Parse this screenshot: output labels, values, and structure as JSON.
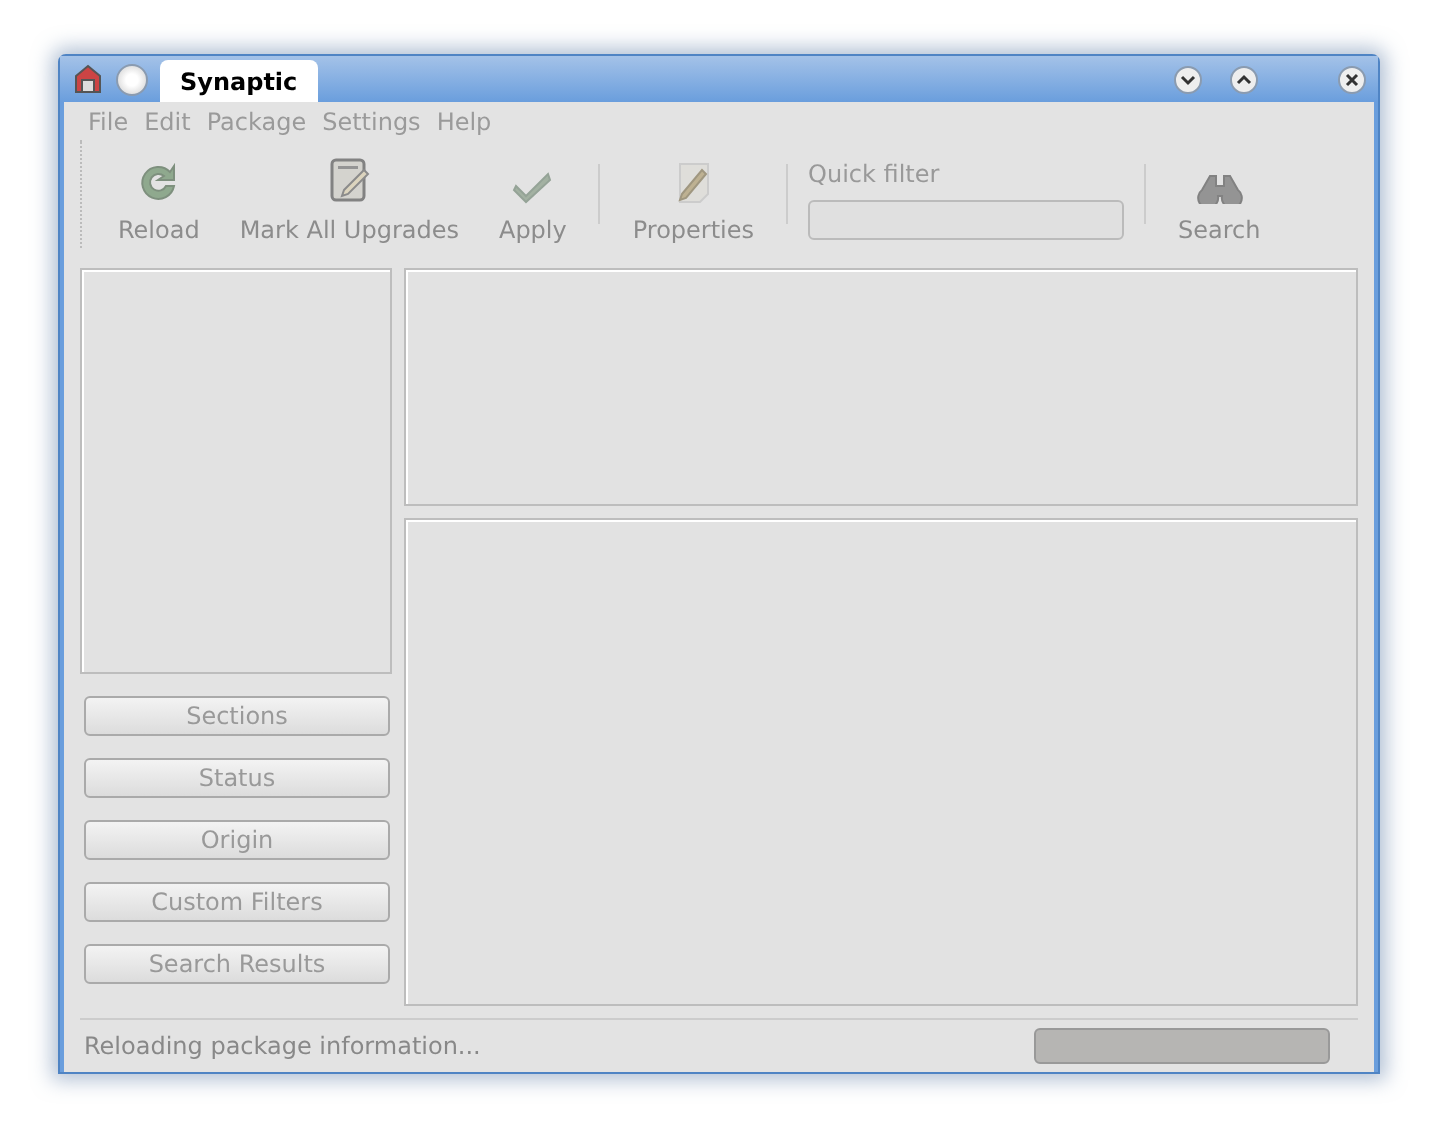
{
  "window": {
    "title": "Synaptic"
  },
  "menu": [
    {
      "label": "File"
    },
    {
      "label": "Edit"
    },
    {
      "label": "Package"
    },
    {
      "label": "Settings"
    },
    {
      "label": "Help"
    }
  ],
  "toolbar": [
    {
      "kind": "reload",
      "label": "Reload",
      "disabled": true
    },
    {
      "kind": "upgrades",
      "label": "Mark All Upgrades",
      "disabled": true
    },
    {
      "kind": "apply",
      "label": "Apply",
      "disabled": true
    },
    {
      "kind": "separator"
    },
    {
      "kind": "properties",
      "label": "Properties",
      "disabled": true
    },
    {
      "kind": "separator"
    },
    {
      "kind": "filter",
      "label": "Quick filter",
      "disabled": true
    },
    {
      "kind": "separator"
    },
    {
      "kind": "search",
      "label": "Search",
      "disabled": true
    }
  ],
  "filter_buttons": [
    {
      "label": "Sections",
      "disabled": true
    },
    {
      "label": "Status",
      "disabled": true
    },
    {
      "label": "Origin",
      "disabled": true
    },
    {
      "label": "Custom Filters",
      "disabled": true
    },
    {
      "label": "Search Results",
      "disabled": true
    }
  ],
  "status_bar": {
    "text": "Reloading package information...",
    "progress": {
      "level": 0
    }
  }
}
